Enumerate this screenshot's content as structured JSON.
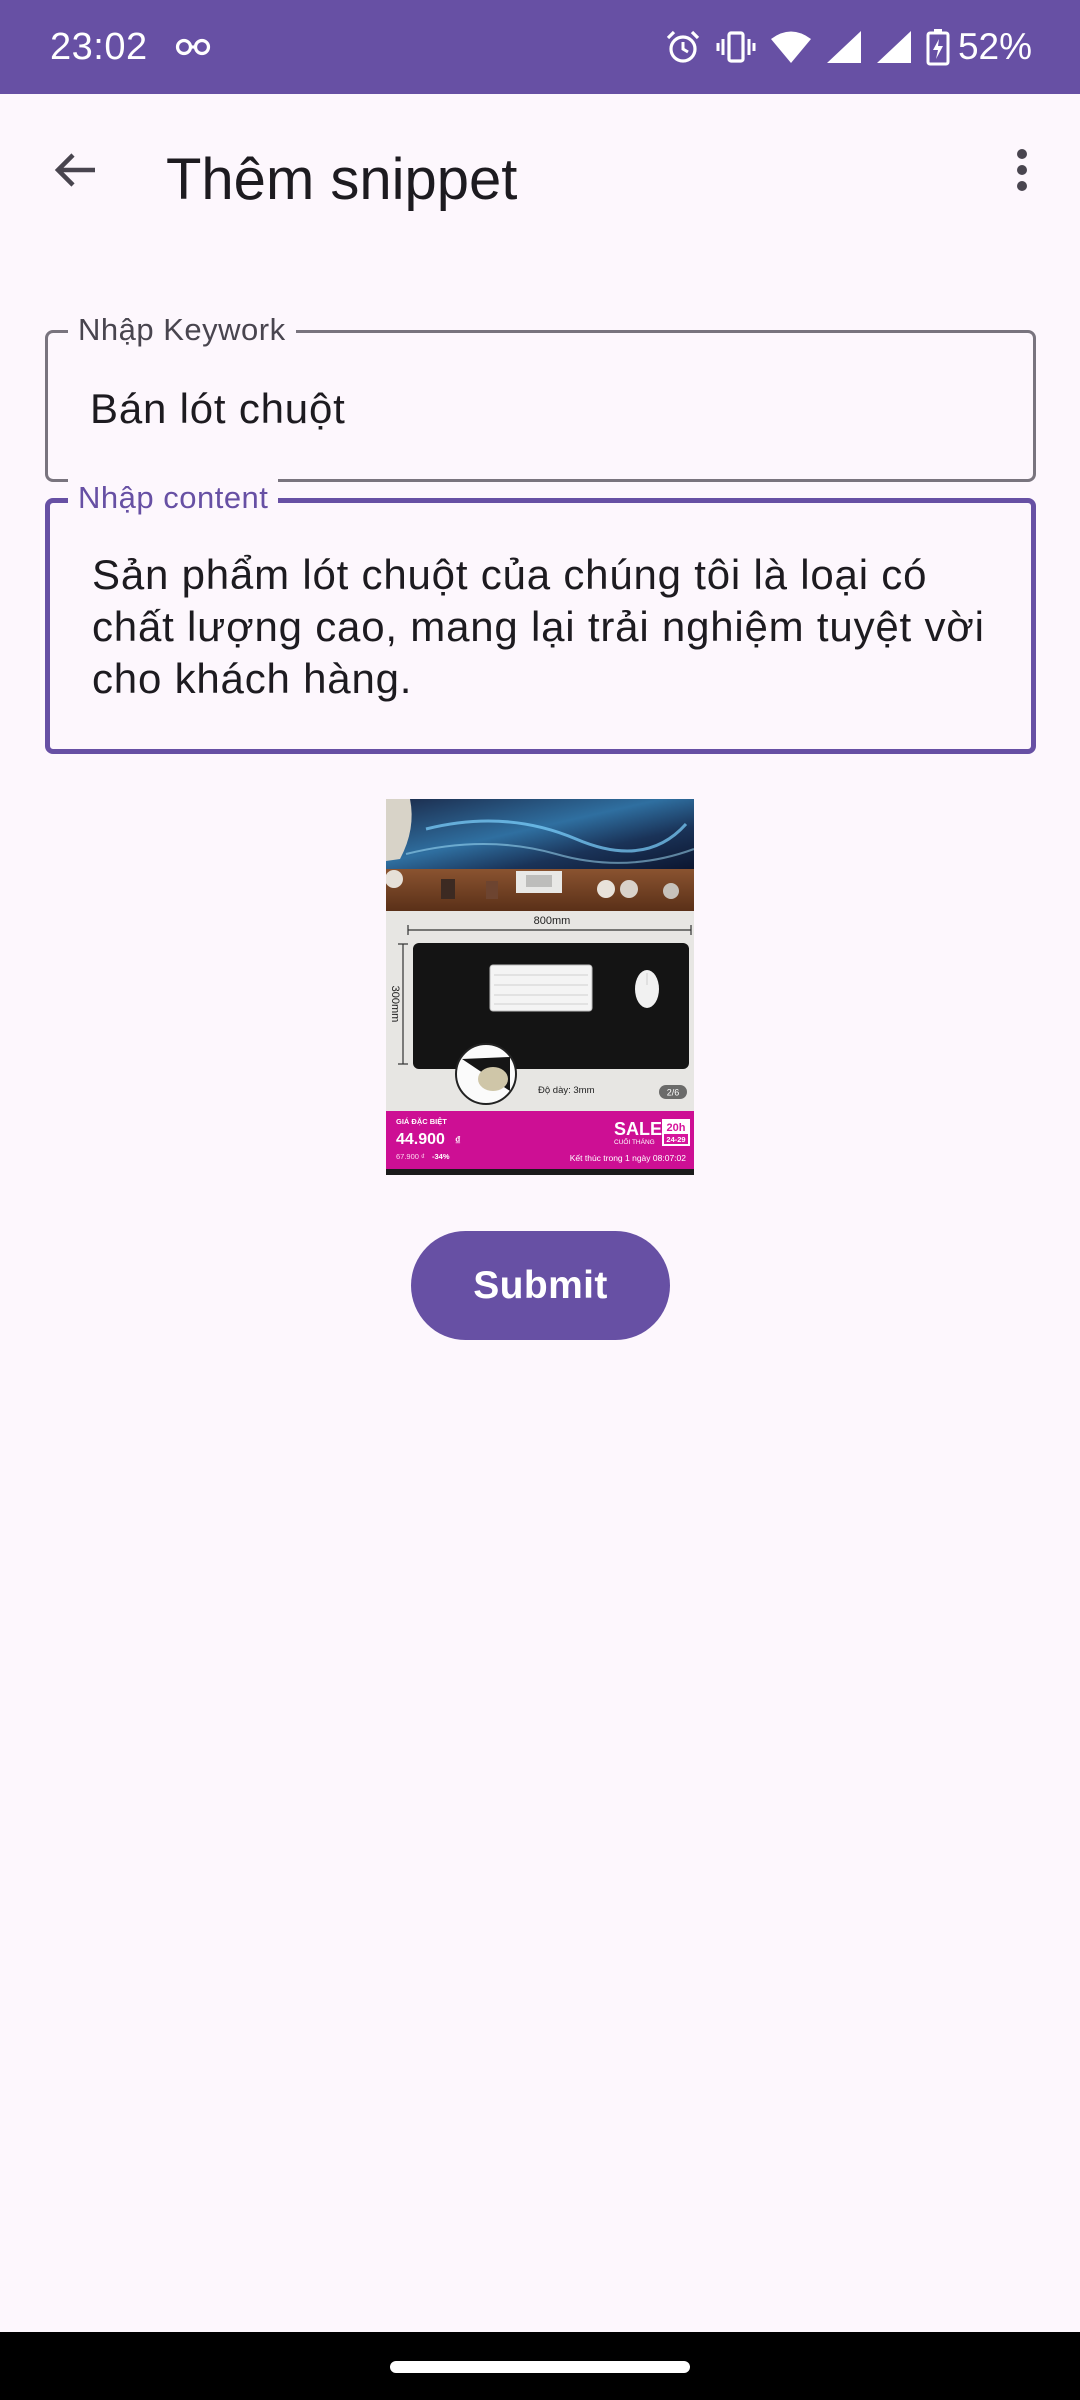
{
  "status_bar": {
    "time": "23:02",
    "battery": "52%",
    "background_color": "#6750a4",
    "icons": [
      "infinity-icon",
      "alarm-icon",
      "vibrate-icon",
      "wifi-icon",
      "signal-icon",
      "signal-icon",
      "battery-charging-icon"
    ]
  },
  "app_bar": {
    "title": "Thêm snippet",
    "back_icon": "arrow-back-icon",
    "menu_icon": "more-vert-icon"
  },
  "form": {
    "keyword_label": "Nhập Keywork",
    "keyword_value": "Bán lót chuột",
    "content_label": "Nhập content",
    "content_value": "Sản phẩm lót chuột của chúng tôi là loại có chất lượng cao, mang lại trải nghiệm tuyệt vời cho khách hàng.",
    "submit_label": "Submit"
  },
  "product_image": {
    "width_label": "800mm",
    "height_label": "300mm",
    "thickness_label": "Độ dày: 3mm",
    "page_counter": "2/6",
    "banner_special_label": "GIÁ ĐẶC BIỆT",
    "banner_price": "44.900",
    "banner_currency": "₫",
    "banner_old_price": "67.900 ₫",
    "banner_discount": "-34%",
    "banner_sale": "SALE",
    "banner_sale_sub": "CUỐI THÁNG",
    "banner_hour": "20h",
    "banner_date": "24-29",
    "banner_countdown": "Kết thúc trong 1 ngày 08:07:02"
  },
  "colors": {
    "primary": "#6750a4",
    "background": "#fdf7fd",
    "outline": "#79747e",
    "banner_pink": "#d6159c"
  }
}
